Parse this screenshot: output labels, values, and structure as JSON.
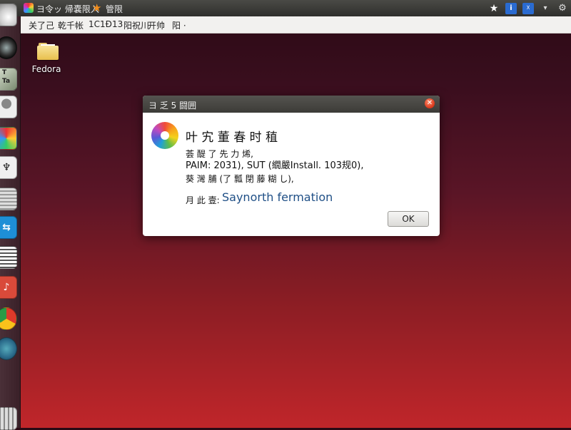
{
  "top_panel": {
    "title": "ヨ令ッ 帰嚢限入",
    "title2": "管限",
    "indicators": [
      {
        "name": "star-icon",
        "glyph": "★"
      },
      {
        "name": "info-badge-icon",
        "glyph": "i"
      },
      {
        "name": "accessibility-badge-icon",
        "glyph": "☓"
      },
      {
        "name": "chevron-down-icon",
        "glyph": "▾"
      },
      {
        "name": "gear-icon",
        "glyph": "⚙"
      }
    ]
  },
  "menu_bar": {
    "items": [
      "关了己",
      "乾千帐",
      "1C1Ð13",
      "阳祝川",
      "开帅",
      "阳 ·"
    ]
  },
  "launcher": {
    "items": [
      {
        "name": "launcher-home-icon",
        "glyph": ""
      },
      {
        "name": "launcher-disc-icon",
        "glyph": ""
      },
      {
        "name": "launcher-app-icon",
        "glyph": "T\nTa"
      },
      {
        "name": "launcher-user-icon",
        "glyph": ""
      },
      {
        "name": "launcher-color-app-icon",
        "glyph": ""
      },
      {
        "name": "launcher-puzzle-icon",
        "glyph": "♆"
      },
      {
        "name": "launcher-grid-icon",
        "glyph": ""
      },
      {
        "name": "launcher-chat-icon",
        "glyph": "⇆"
      },
      {
        "name": "launcher-document-icon",
        "glyph": ""
      },
      {
        "name": "launcher-music-icon",
        "glyph": "♪"
      },
      {
        "name": "launcher-chrome-icon",
        "glyph": ""
      },
      {
        "name": "launcher-globe-icon",
        "glyph": ""
      },
      {
        "name": "launcher-workspace-icon",
        "glyph": ""
      }
    ]
  },
  "desktop": {
    "icon_label": "Fedora"
  },
  "dialog": {
    "title": "ヨ 乏 5 闘囲",
    "heading": "叶 宄 董 春 时 稙",
    "line1": "荟 醍 了 先 力 烯,",
    "line2": "PAIM: 2031), SUT (繝嚴Install. 103规0),",
    "line3": "葵 灣 脯 (了 瓢 閉 藤 糊 し),",
    "info_label": "月 此 壹:",
    "info_value": "Saynorth fermation",
    "ok_label": "OK",
    "close_glyph": "✕"
  }
}
